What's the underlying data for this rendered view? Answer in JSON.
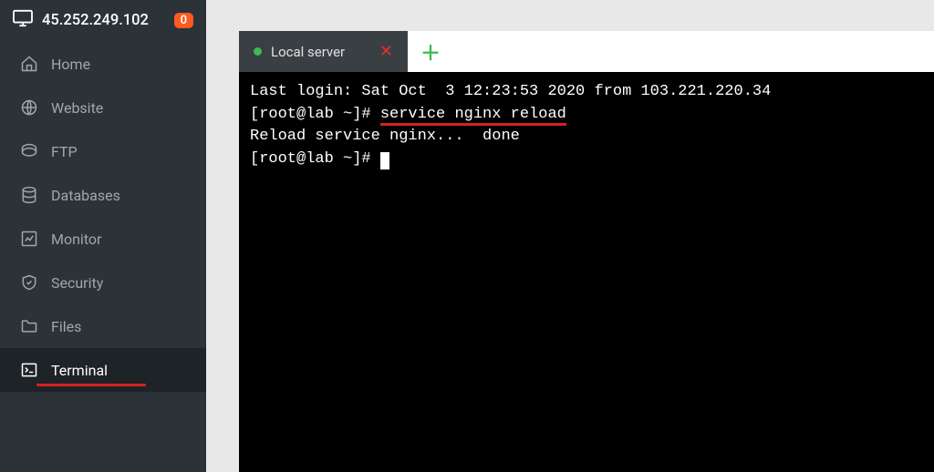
{
  "header": {
    "ip": "45.252.249.102",
    "badge_count": "0"
  },
  "sidebar": {
    "items": [
      {
        "label": "Home"
      },
      {
        "label": "Website"
      },
      {
        "label": "FTP"
      },
      {
        "label": "Databases"
      },
      {
        "label": "Monitor"
      },
      {
        "label": "Security"
      },
      {
        "label": "Files"
      },
      {
        "label": "Terminal"
      }
    ]
  },
  "tabs": {
    "active_label": "Local server"
  },
  "terminal": {
    "line1": "Last login: Sat Oct  3 12:23:53 2020 from 103.221.220.34",
    "prompt1": "[root@lab ~]# ",
    "command1": "service nginx reload",
    "line3": "Reload service nginx...  done",
    "prompt2": "[root@lab ~]# "
  }
}
